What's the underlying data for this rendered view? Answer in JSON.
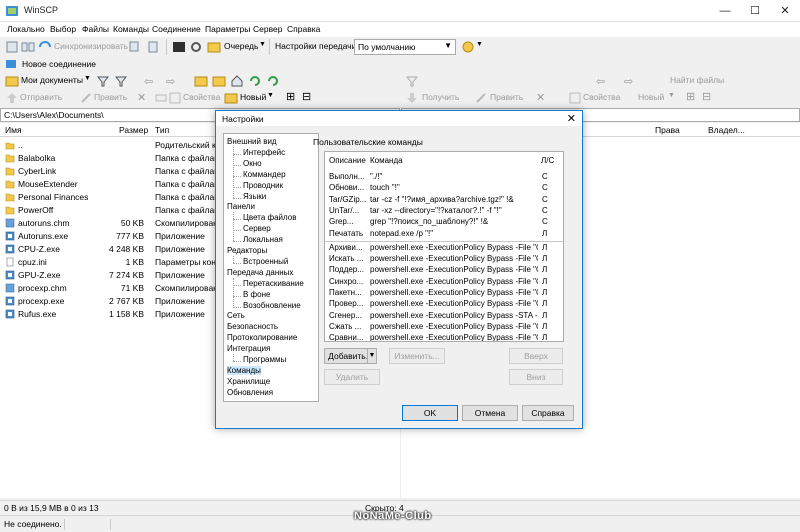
{
  "window": {
    "title": "WinSCP",
    "minimize": "—",
    "maximize": "☐",
    "close": "✕"
  },
  "menu": [
    "Локально",
    "Выбор",
    "Файлы",
    "Команды",
    "Соединение",
    "Параметры",
    "Сервер",
    "Справка"
  ],
  "toolbar1": {
    "sync_label": "Синхронизировать",
    "queue_label": "Очередь",
    "transfer_label": "Настройки передачи",
    "transfer_value": "По умолчанию"
  },
  "toolbar2": {
    "new_session": "Новое соединение"
  },
  "left_toolbar": {
    "location": "Мои документы",
    "send": "Отправить",
    "edit": "Править",
    "properties": "Свойства",
    "new": "Новый"
  },
  "right_toolbar": {
    "find_files": "Найти файлы",
    "receive": "Получить",
    "edit": "Править",
    "properties": "Свойства",
    "new": "Новый"
  },
  "left_panel": {
    "path": "C:\\Users\\Alex\\Documents\\",
    "columns": {
      "name": "Имя",
      "size": "Размер",
      "type": "Тип"
    },
    "rows": [
      {
        "name": "..",
        "size": "",
        "type": "Родительский ка",
        "icon": "parent"
      },
      {
        "name": "Balabolka",
        "size": "",
        "type": "Папка с файлами",
        "icon": "folder"
      },
      {
        "name": "CyberLink",
        "size": "",
        "type": "Папка с файлами",
        "icon": "folder"
      },
      {
        "name": "MouseExtender",
        "size": "",
        "type": "Папка с файлами",
        "icon": "folder"
      },
      {
        "name": "Personal Finances",
        "size": "",
        "type": "Папка с файлами",
        "icon": "folder"
      },
      {
        "name": "PowerOff",
        "size": "",
        "type": "Папка с файлами",
        "icon": "folder"
      },
      {
        "name": "autoruns.chm",
        "size": "50 KB",
        "type": "Скомпилирован",
        "icon": "chm"
      },
      {
        "name": "Autoruns.exe",
        "size": "777 KB",
        "type": "Приложение",
        "icon": "exe"
      },
      {
        "name": "CPU-Z.exe",
        "size": "4 248 KB",
        "type": "Приложение",
        "icon": "exe"
      },
      {
        "name": "cpuz.ini",
        "size": "1 KB",
        "type": "Параметры конф",
        "icon": "ini"
      },
      {
        "name": "GPU-Z.exe",
        "size": "7 274 KB",
        "type": "Приложение",
        "icon": "exe"
      },
      {
        "name": "procexp.chm",
        "size": "71 KB",
        "type": "Скомпилирован",
        "icon": "chm"
      },
      {
        "name": "procexp.exe",
        "size": "2 767 KB",
        "type": "Приложение",
        "icon": "exe"
      },
      {
        "name": "Rufus.exe",
        "size": "1 158 KB",
        "type": "Приложение",
        "icon": "exe"
      }
    ]
  },
  "right_panel": {
    "columns": {
      "rights": "Права",
      "owner": "Владел..."
    }
  },
  "status": {
    "left": "0 B из 15,9 MB в 0 из 13",
    "hidden": "Скрыто: 4",
    "connection": "Не соединено."
  },
  "dialog": {
    "title": "Настройки",
    "close": "✕",
    "tree": [
      {
        "label": "Внешний вид",
        "level": 0
      },
      {
        "label": "Интерфейс",
        "level": 1
      },
      {
        "label": "Окно",
        "level": 1
      },
      {
        "label": "Коммандер",
        "level": 1
      },
      {
        "label": "Проводник",
        "level": 1
      },
      {
        "label": "Языки",
        "level": 1
      },
      {
        "label": "Панели",
        "level": 0
      },
      {
        "label": "Цвета файлов",
        "level": 1
      },
      {
        "label": "Сервер",
        "level": 1
      },
      {
        "label": "Локальная",
        "level": 1
      },
      {
        "label": "Редакторы",
        "level": 0
      },
      {
        "label": "Встроенный",
        "level": 1
      },
      {
        "label": "Передача данных",
        "level": 0
      },
      {
        "label": "Перетаскивание",
        "level": 1
      },
      {
        "label": "В фоне",
        "level": 1
      },
      {
        "label": "Возобновление",
        "level": 1
      },
      {
        "label": "Сеть",
        "level": 0
      },
      {
        "label": "Безопасность",
        "level": 0
      },
      {
        "label": "Протоколирование",
        "level": 0
      },
      {
        "label": "Интеграция",
        "level": 0
      },
      {
        "label": "Программы",
        "level": 1
      },
      {
        "label": "Команды",
        "level": 0,
        "selected": true
      },
      {
        "label": "Хранилище",
        "level": 0
      },
      {
        "label": "Обновления",
        "level": 0
      }
    ],
    "group_title": "Пользовательские команды",
    "list_columns": {
      "desc": "Описание",
      "cmd": "Команда",
      "ls": "Л/С"
    },
    "commands_a": [
      {
        "desc": "Выполн...",
        "cmd": "\"./!\"",
        "ls": "С"
      },
      {
        "desc": "Обнови...",
        "cmd": "touch \"!\"",
        "ls": "С"
      },
      {
        "desc": "Tar/GZip...",
        "cmd": "tar -cz  -f \"!?имя_архива?archive.tgz!\" !&",
        "ls": "С"
      },
      {
        "desc": "UnTar/...",
        "cmd": "tar -xz --directory=\"!?каталог?.!\" -f \"!\"",
        "ls": "С"
      },
      {
        "desc": "Grep...",
        "cmd": "grep \"!?поиск_по_шаблону?!\" !&",
        "ls": "С"
      },
      {
        "desc": "Печатать",
        "cmd": "notepad.exe /p \"!\"",
        "ls": "Л"
      }
    ],
    "commands_b": [
      {
        "desc": "Архиви...",
        "cmd": "powershell.exe -ExecutionPolicy Bypass -File \"C...",
        "ls": "Л"
      },
      {
        "desc": "Искать ...",
        "cmd": "powershell.exe -ExecutionPolicy Bypass -File \"C...",
        "ls": "Л"
      },
      {
        "desc": "Поддер...",
        "cmd": "powershell.exe -ExecutionPolicy Bypass -File \"C...",
        "ls": "Л"
      },
      {
        "desc": "Синхро...",
        "cmd": "powershell.exe -ExecutionPolicy Bypass -File \"C...",
        "ls": "Л"
      },
      {
        "desc": "Пакетн...",
        "cmd": "powershell.exe -ExecutionPolicy Bypass -File \"C...",
        "ls": "Л"
      },
      {
        "desc": "Провер...",
        "cmd": "powershell.exe -ExecutionPolicy Bypass -File \"C...",
        "ls": "Л"
      },
      {
        "desc": "Сгенер...",
        "cmd": "powershell.exe -ExecutionPolicy Bypass -STA -...",
        "ls": "Л"
      },
      {
        "desc": "Сжать ...",
        "cmd": "powershell.exe -ExecutionPolicy Bypass -File \"C...",
        "ls": "Л"
      },
      {
        "desc": "Сравни...",
        "cmd": "powershell.exe -ExecutionPolicy Bypass -File \"C...",
        "ls": "Л"
      }
    ],
    "buttons": {
      "add": "Добавить...",
      "change": "Изменить...",
      "up": "Вверх",
      "remove": "Удалить",
      "down": "Вниз",
      "ok": "OK",
      "cancel": "Отмена",
      "help": "Справка"
    }
  },
  "watermark": "NoNaMe-Club",
  "colors": {
    "accent": "#0078d7",
    "folder": "#f2c94c",
    "selection": "#cce8ff"
  }
}
